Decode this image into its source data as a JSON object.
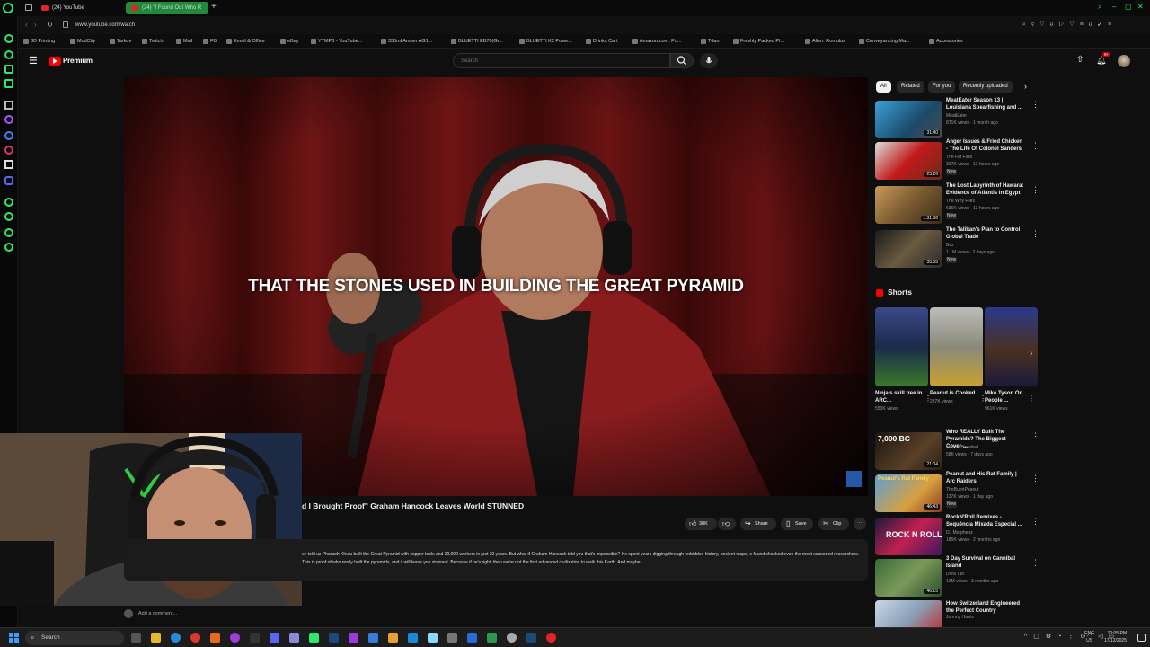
{
  "browser": {
    "tabs": [
      {
        "label": "(24) YouTube"
      },
      {
        "label": "(24) \"I Found Out Who R"
      }
    ],
    "url": "www.youtube.com/watch",
    "bookmarks": [
      "3D Printing",
      "ModCity",
      "Tarkov",
      "Twitch",
      "Mail",
      "FB",
      "Email & Office",
      "eBay",
      "YTMP3 - YouTube...",
      "330ml Amber AG1...",
      "BLUETTI EB70(Gr...",
      "BLUETTI K2 Powe...",
      "Drinks Cart",
      "Amazon.com: Pu...",
      "Tdarr",
      "Freshly Packed Pl...",
      "Alien: Romulus",
      "Conveyancing Ma...",
      "Accessories"
    ]
  },
  "youtube": {
    "logo_label": "Premium",
    "search_placeholder": "Search",
    "notification_count": "9+",
    "video": {
      "subtitle": "THAT THE STONES USED IN BUILDING THE GREAT PYRAMID",
      "title": "d I Brought Proof\" Graham Hancock Leaves World STUNNED",
      "actions": {
        "likes": "38K",
        "share": "Share",
        "save": "Save",
        "clip": "Clip"
      },
      "description": "ey told us Pharaoh Khufu built the Great Pyramid with copper tools and 20,000 workers in just 20 years. But what if Graham Hancock told you that's impossible? He spent years digging through forbidden history, ancient maps, e found shocked even the most seasoned researchers. This is proof of who really built the pyramids, and it will leave you stunned. Because if he's right, then we're not the first advanced civilization to walk this Earth. And maybe",
      "comment_placeholder": "Add a comment..."
    },
    "chips": [
      "All",
      "Related",
      "For you",
      "Recently uploaded"
    ],
    "recommendations_top": [
      {
        "title": "MeatEater Season 13 | Louisiana Spearfishing and ...",
        "channel": "MeatEater",
        "meta": "871K views · 1 month ago",
        "badge": "",
        "duration": "31:40"
      },
      {
        "title": "Anger Issues & Fried Chicken - The Life Of Colonel Sanders",
        "channel": "The Fat Files",
        "meta": "307K views · 13 hours ago",
        "badge": "New",
        "duration": "23:26"
      },
      {
        "title": "The Lost Labyrinth of Hawara: Evidence of Atlantis in Egypt",
        "channel": "The Why Files",
        "meta": "636K views · 13 hours ago",
        "badge": "New",
        "duration": "1:31:36"
      },
      {
        "title": "The Taliban's Plan to Control Global Trade",
        "channel": "Bez",
        "meta": "1.1M views · 2 days ago",
        "badge": "New",
        "duration": "35:55"
      }
    ],
    "shorts_title": "Shorts",
    "shorts": [
      {
        "title": "Ninja's skill tree in ARC...",
        "views": "550K views"
      },
      {
        "title": "Peanut is Cooked",
        "views": "237K views"
      },
      {
        "title": "Mike Tyson On People ...",
        "views": "961K views"
      }
    ],
    "recommendations_bottom": [
      {
        "title": "Who REALLY Built The Pyramids? The Biggest Cover-...",
        "channel": "Nature Unveiled",
        "meta": "58K views · 7 days ago",
        "badge": "",
        "duration": "21:04",
        "thumb_text": "7,000 BC"
      },
      {
        "title": "Peanut and His Rat Family | Arc Raiders",
        "channel": "TheBurntPeanut",
        "meta": "137K views · 1 day ago",
        "badge": "New",
        "duration": "46:43",
        "thumb_text": "Peanut's Rat Family"
      },
      {
        "title": "RockN'Roll Remixes - Sequência Mixada Especial ...",
        "channel": "DJ Morpheuz",
        "meta": "186K views · 2 months ago",
        "badge": "",
        "duration": "",
        "thumb_text": "ROCK N ROLL"
      },
      {
        "title": "3 Day Survival on Cannibal Island",
        "channel": "Dora Tah",
        "meta": "12M views · 3 months ago",
        "badge": "",
        "duration": "46:15",
        "thumb_text": ""
      },
      {
        "title": "How Switzerland Engineered the Perfect Country",
        "channel": "Johnny Harris",
        "meta": "",
        "badge": "",
        "duration": "",
        "thumb_text": ""
      }
    ]
  },
  "taskbar": {
    "search_label": "Search",
    "lang_top": "ENG",
    "lang_bottom": "US",
    "time": "10:05 PM",
    "date": "17/12/2025"
  }
}
